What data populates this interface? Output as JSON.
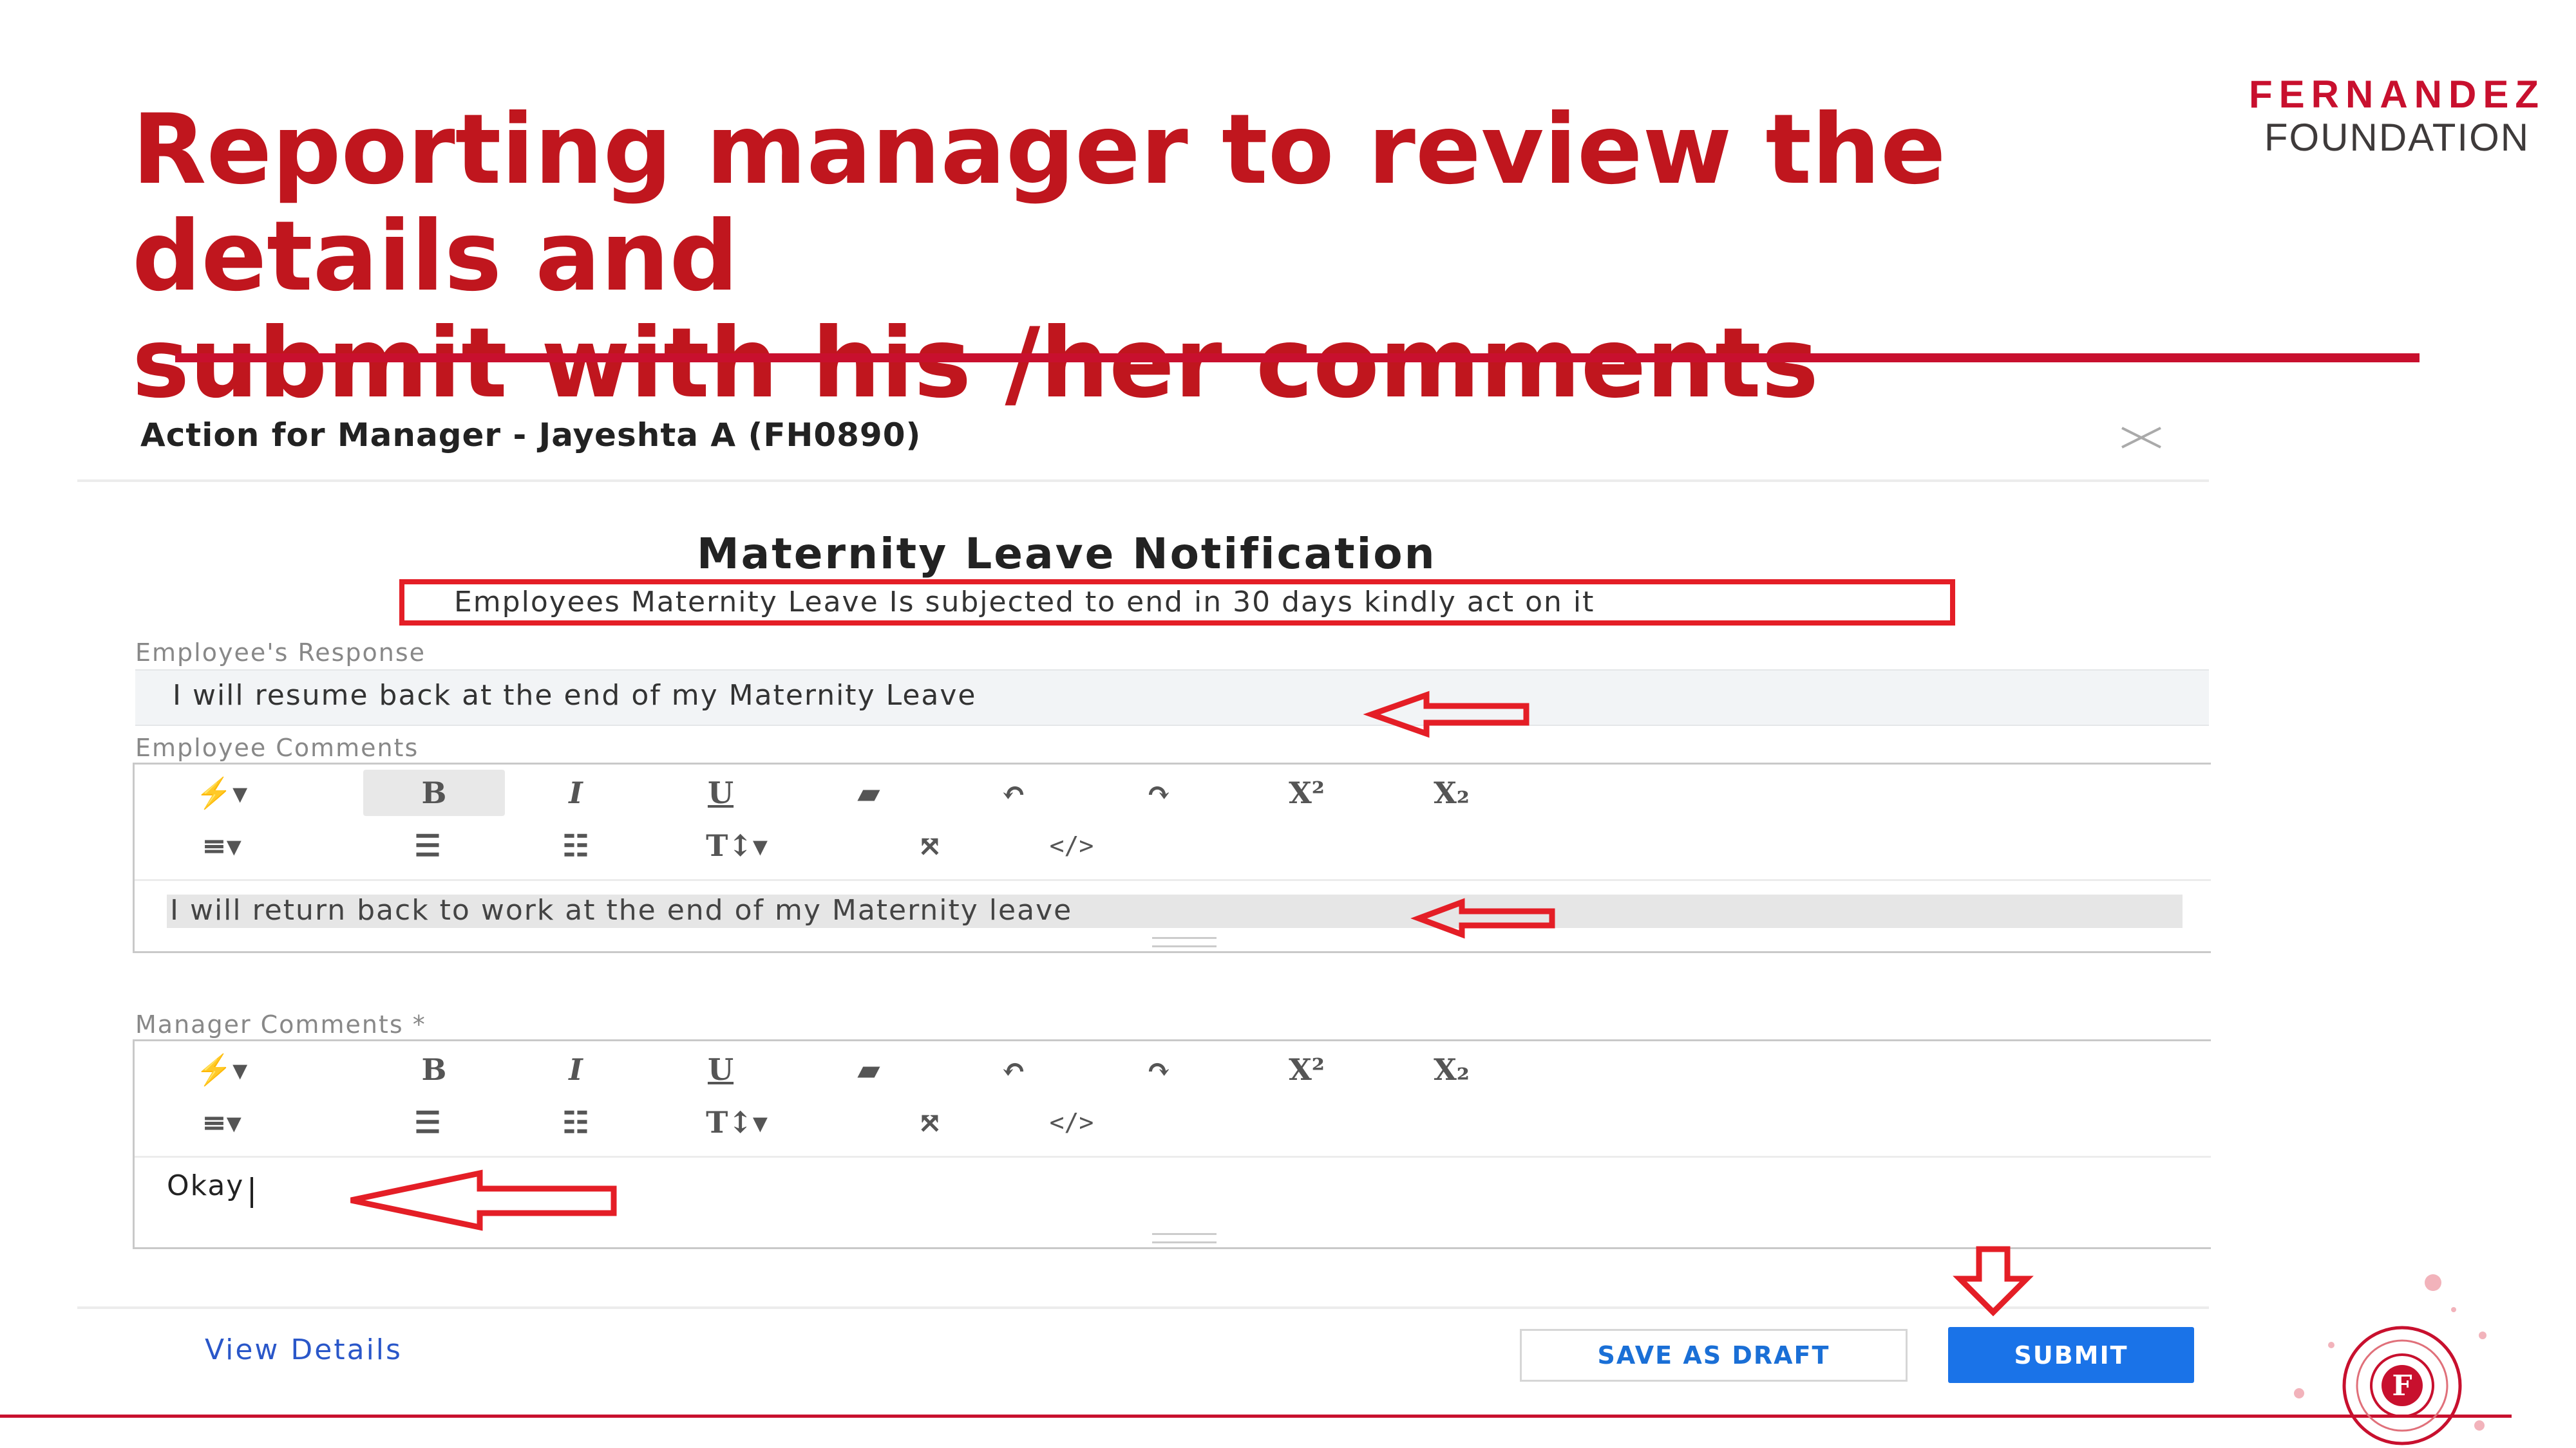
{
  "slide": {
    "title_line1": "Reporting manager to review the details and",
    "title_line2": "submit with his /her comments",
    "brand_top": "FERNANDEZ",
    "brand_bottom": "FOUNDATION",
    "accent_color": "#c8102e",
    "logo_letter": "F"
  },
  "dialog": {
    "title": "Action for Manager - Jayeshta A (FH0890)",
    "close_icon": "close-icon",
    "notification_title": "Maternity Leave Notification",
    "notification_message": "Employees Maternity Leave Is subjected to end in 30 days kindly act on it",
    "employee_response_label": "Employee's Response",
    "employee_response_value": "I will resume back at the end of my Maternity  Leave",
    "employee_comments_label": "Employee Comments",
    "employee_comments_value": "I will return back to work at the end of my Maternity leave",
    "manager_comments_label": "Manager Comments *",
    "manager_comments_value": "Okay",
    "toolbar": {
      "row1": [
        {
          "icon": "magic-wand-icon",
          "glyph": "⚡▾"
        },
        {
          "icon": "bold-icon",
          "glyph": "B"
        },
        {
          "icon": "italic-icon",
          "glyph": "I"
        },
        {
          "icon": "underline-icon",
          "glyph": "U"
        },
        {
          "icon": "eraser-icon",
          "glyph": "▰"
        },
        {
          "icon": "undo-icon",
          "glyph": "↶"
        },
        {
          "icon": "redo-icon",
          "glyph": "↷"
        },
        {
          "icon": "superscript-icon",
          "glyph": "X²"
        },
        {
          "icon": "subscript-icon",
          "glyph": "X₂"
        }
      ],
      "row2": [
        {
          "icon": "align-icon",
          "glyph": "≡▾"
        },
        {
          "icon": "bullet-list-icon",
          "glyph": "☰"
        },
        {
          "icon": "numbered-list-icon",
          "glyph": "☷"
        },
        {
          "icon": "text-height-icon",
          "glyph": "T↕▾"
        },
        {
          "icon": "fullscreen-icon",
          "glyph": "⤧"
        },
        {
          "icon": "code-view-icon",
          "glyph": "</>"
        }
      ]
    },
    "view_details": "View Details",
    "save_draft": "SAVE AS DRAFT",
    "submit": "SUBMIT",
    "submit_color": "#1a73e8"
  }
}
